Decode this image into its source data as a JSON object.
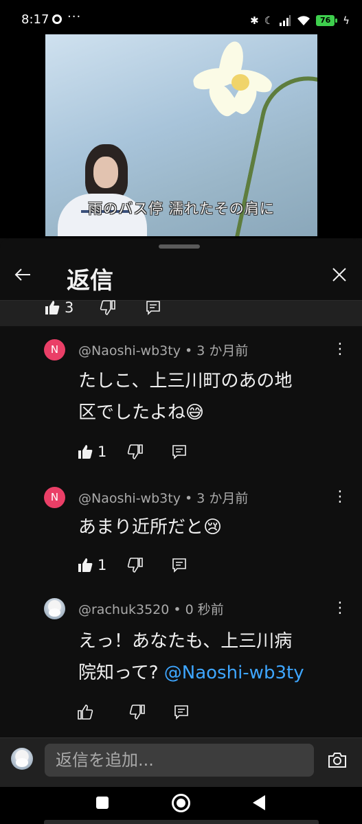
{
  "status_bar": {
    "time": "8:17",
    "dots": "···",
    "icons": [
      "bluetooth-icon",
      "moon-icon",
      "signal-icon",
      "wifi-icon"
    ],
    "battery": "76"
  },
  "video": {
    "subtitle": "雨のバス停 濡れたその肩に"
  },
  "sheet": {
    "title": "返信",
    "parent_like_count": "3"
  },
  "comments": [
    {
      "avatar_letter": "N",
      "author": "@Naoshi-wb3ty",
      "time": "3 か月前",
      "text_line1": "たしこ、上三川町のあの地",
      "text_line2": "区でしたよね😅",
      "likes": "1"
    },
    {
      "avatar_letter": "N",
      "author": "@Naoshi-wb3ty",
      "time": "3 か月前",
      "text_line1": "あまり近所だと😢",
      "likes": "1"
    },
    {
      "author": "@rachuk3520",
      "time": "0 秒前",
      "text_line1": "えっ！あなたも、上三川病",
      "text_line2": "院知って? ",
      "mention": "@Naoshi-wb3ty"
    }
  ],
  "compose": {
    "placeholder": "返信を追加..."
  },
  "colors": {
    "background": "#0f0f0f",
    "accent_link": "#3ea6ff",
    "avatar_n": "#ea3f67",
    "battery": "#3ecf4d"
  }
}
